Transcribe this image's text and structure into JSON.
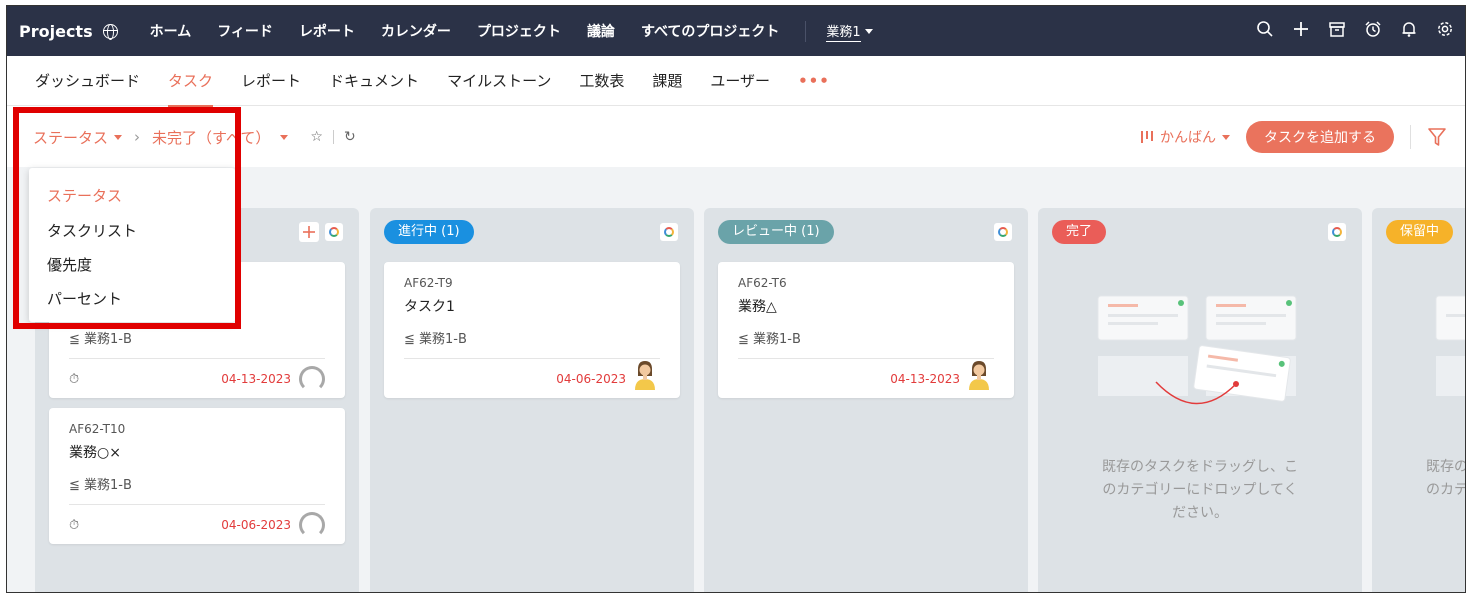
{
  "topbar": {
    "brand": "Projects",
    "nav": [
      "ホーム",
      "フィード",
      "レポート",
      "カレンダー",
      "プロジェクト",
      "議論",
      "すべてのプロジェクト"
    ],
    "project": "業務1",
    "icons": [
      "search-icon",
      "plus-icon",
      "store-icon",
      "alarm-icon",
      "bell-icon",
      "settings-icon"
    ]
  },
  "subnav": {
    "items": [
      "ダッシュボード",
      "タスク",
      "レポート",
      "ドキュメント",
      "マイルストーン",
      "工数表",
      "課題",
      "ユーザー"
    ],
    "active": "タスク",
    "more": "•••"
  },
  "toolbar": {
    "group_by": "ステータス",
    "filter": "未完了（すべて）",
    "view_mode": "かんばん",
    "add_task": "タスクを追加する"
  },
  "dropdown": {
    "items": [
      "ステータス",
      "タスクリスト",
      "優先度",
      "パーセント"
    ],
    "selected": "ステータス"
  },
  "columns": [
    {
      "label": "",
      "cards": [
        {
          "id": "",
          "title": "",
          "list": "業務1-B",
          "date": "04-13-2023"
        },
        {
          "id": "AF62-T10",
          "title": "業務○×",
          "list": "業務1-B",
          "date": "04-06-2023"
        }
      ]
    },
    {
      "label": "進行中 (1)",
      "color": "#1a90e0",
      "cards": [
        {
          "id": "AF62-T9",
          "title": "タスク1",
          "list": "業務1-B",
          "date": "04-06-2023"
        }
      ]
    },
    {
      "label": "レビュー中 (1)",
      "color": "#6aa3a9",
      "cards": [
        {
          "id": "AF62-T6",
          "title": "業務△",
          "list": "業務1-B",
          "date": "04-13-2023"
        }
      ]
    },
    {
      "label": "完了",
      "color": "#ea5d58",
      "empty_text": "既存のタスクをドラッグし、このカテゴリーにドロップしてください。",
      "empty_lines": [
        "既存のタスクをドラッグし、こ",
        "のカテゴリーにドロップしてく",
        "ださい。"
      ]
    },
    {
      "label": "保留中",
      "color": "#f6b229",
      "empty_lines": [
        "既存の",
        "のカテ"
      ]
    }
  ],
  "colors": {
    "accent": "#e9705a",
    "topbar": "#2b3247",
    "due_date": "#e23b3b",
    "highlight": "#e00000"
  }
}
